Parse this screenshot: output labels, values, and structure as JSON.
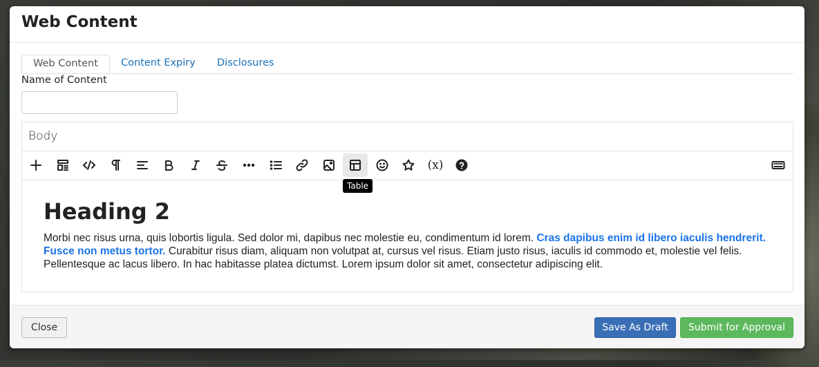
{
  "modal": {
    "title": "Web Content"
  },
  "tabs": [
    {
      "label": "Web Content",
      "active": true
    },
    {
      "label": "Content Expiry",
      "active": false
    },
    {
      "label": "Disclosures",
      "active": false
    }
  ],
  "name_field": {
    "label": "Name of Content",
    "value": "",
    "placeholder": ""
  },
  "editor": {
    "label": "Body",
    "toolbar": [
      {
        "icon": "plus-icon"
      },
      {
        "icon": "template-icon"
      },
      {
        "icon": "code-icon"
      },
      {
        "icon": "paragraph-icon"
      },
      {
        "icon": "align-left-icon"
      },
      {
        "icon": "bold-icon"
      },
      {
        "icon": "italic-icon"
      },
      {
        "icon": "strikethrough-icon"
      },
      {
        "icon": "more-icon"
      },
      {
        "icon": "bullet-list-icon"
      },
      {
        "icon": "link-icon"
      },
      {
        "icon": "image-icon"
      },
      {
        "icon": "table-icon"
      },
      {
        "icon": "emoji-icon"
      },
      {
        "icon": "star-icon"
      },
      {
        "icon": "variable-icon",
        "text": "(x)"
      },
      {
        "icon": "help-icon"
      },
      {
        "icon": "keyboard-icon"
      }
    ],
    "tooltip": "Table",
    "heading": "Heading 2",
    "paragraph_before": "Morbi nec risus urna, quis lobortis ligula. Sed dolor mi, dapibus nec molestie eu, condimentum id lorem. ",
    "paragraph_link": "Cras dapibus enim id libero iaculis hendrerit. Fusce non metus tortor.",
    "paragraph_after": " Curabitur risus diam, aliquam non volutpat at, cursus vel risus. Etiam justo risus, iaculis id commodo et, molestie vel felis. Pellentesque ac lacus libero. In hac habitasse platea dictumst. Lorem ipsum dolor sit amet, consectetur adipiscing elit."
  },
  "footer": {
    "close_label": "Close",
    "draft_label": "Save As Draft",
    "submit_label": "Submit for Approval"
  },
  "colors": {
    "tab_link": "#1a6fb5",
    "link_text": "#1a73e8",
    "draft_button": "#3a6fb5",
    "submit_button": "#5cb85c"
  }
}
